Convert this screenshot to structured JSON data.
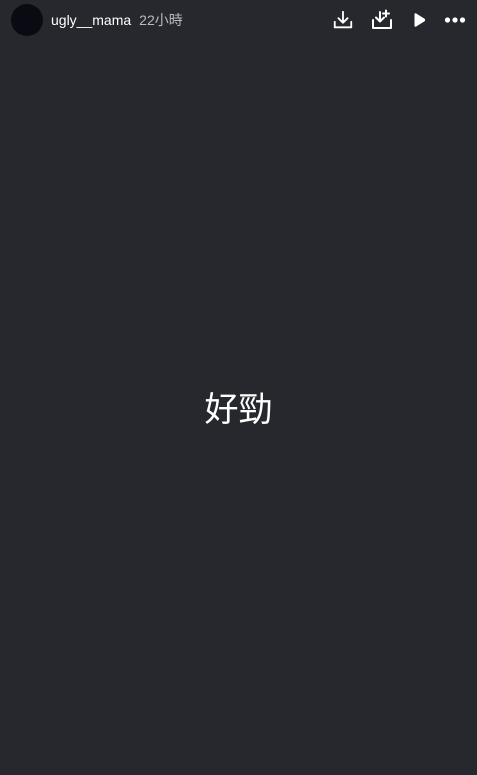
{
  "header": {
    "username": "ugly__mama",
    "time": "22小時",
    "icons": {
      "download": "download-icon",
      "save": "save-to-tray-icon",
      "play": "play-icon",
      "more": "more-options-icon"
    }
  },
  "content": {
    "text": "好勁"
  },
  "colors": {
    "background": "#26282e",
    "avatar": "#0a0a12",
    "text": "#ffffff",
    "muted": "#b9bac0"
  }
}
